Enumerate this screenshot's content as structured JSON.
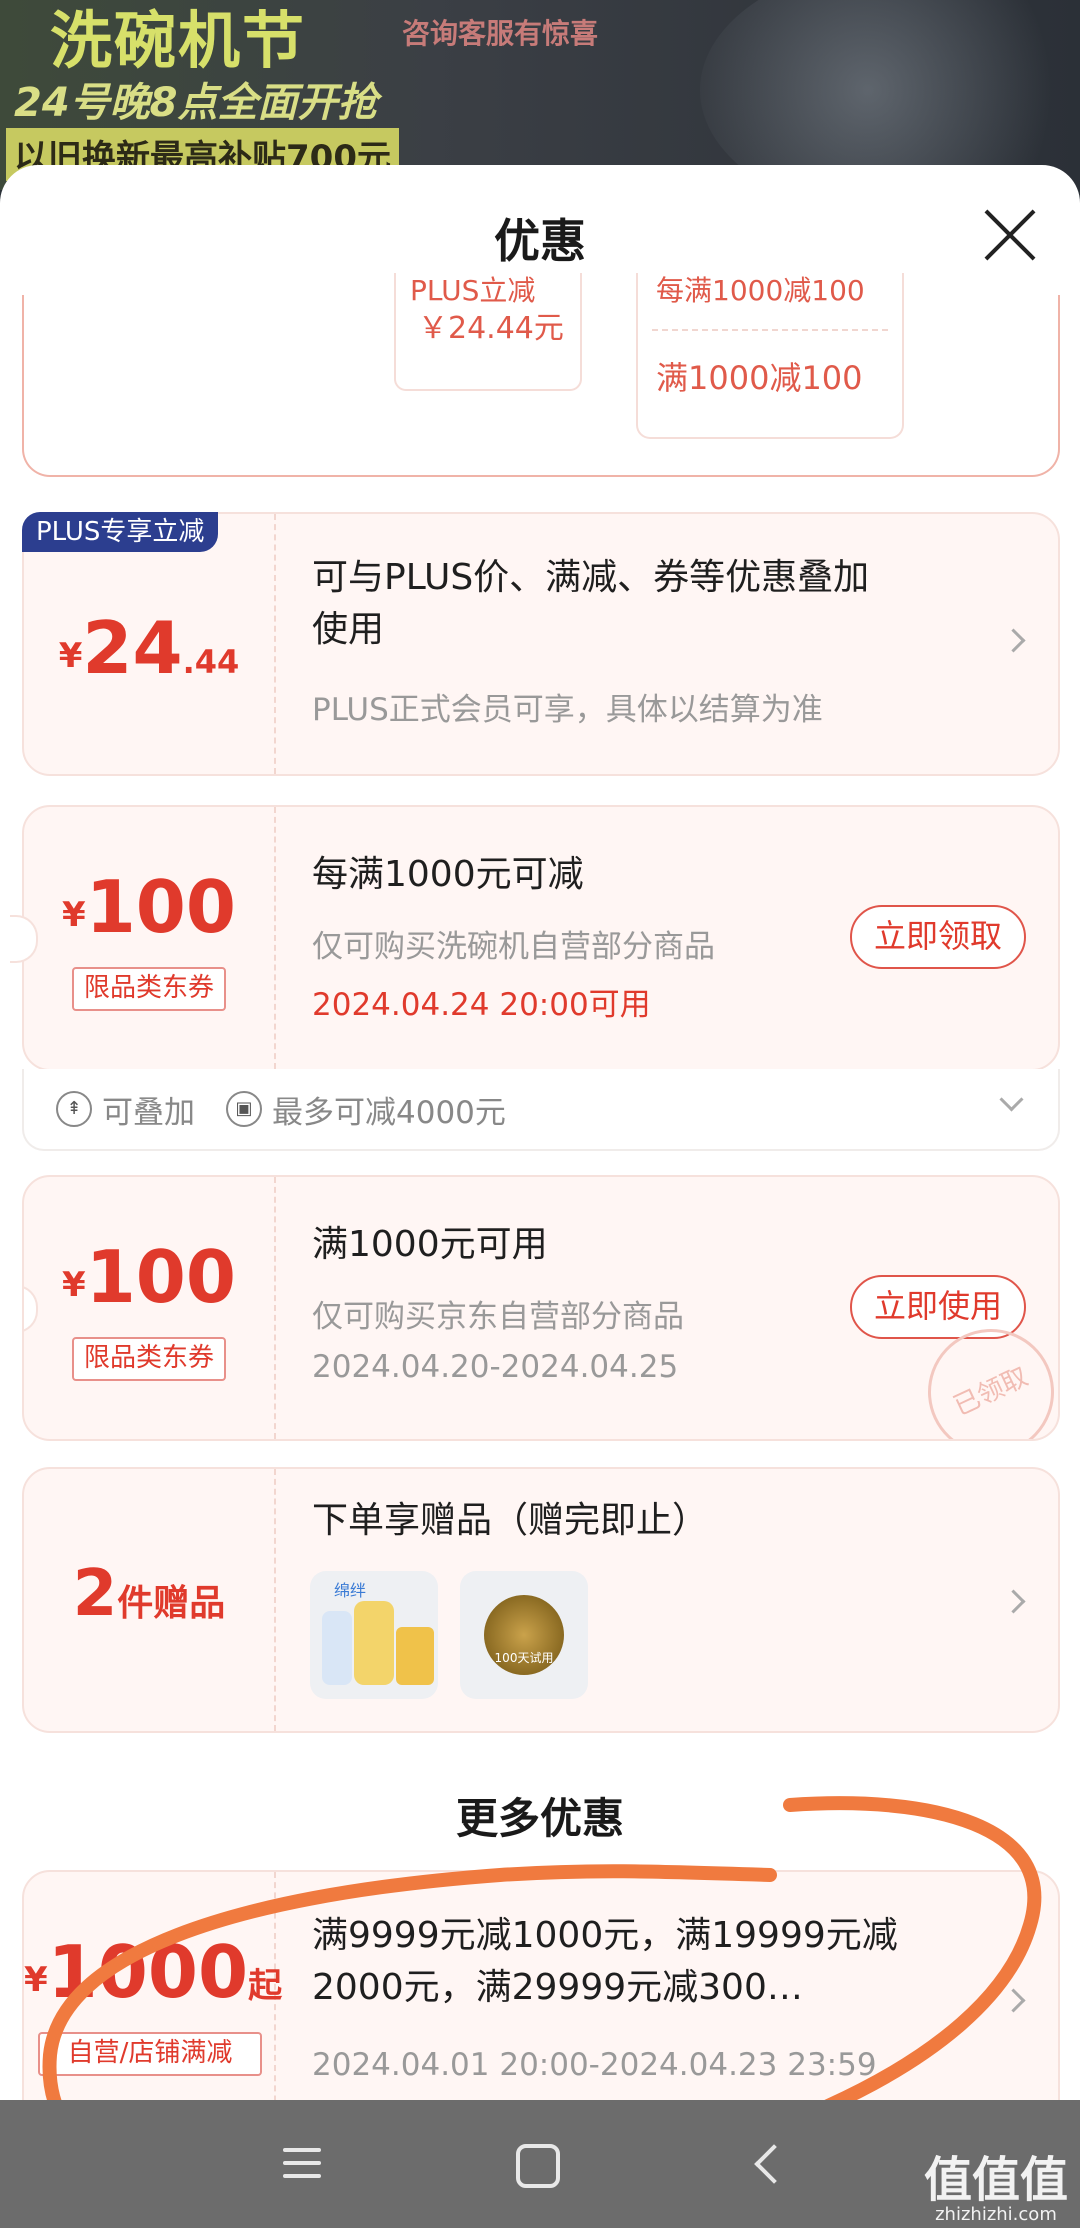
{
  "banner": {
    "title": "洗碗机节",
    "subtitle": "24号晚8点全面开抢",
    "tradein": "以旧换新最高补贴700元",
    "service": "咨询客服有惊喜"
  },
  "sheet": {
    "title": "优惠"
  },
  "top_card": {
    "mini1_line1": "PLUS立减",
    "mini1_line2": "￥24.44元",
    "mini2_line1": "每满1000减100",
    "mini2_line2": "满1000减100"
  },
  "plus_card": {
    "badge": "PLUS专享立减",
    "yen": "¥",
    "amount_int": "24",
    "amount_dec": ".44",
    "title": "可与PLUS价、满减、券等优惠叠加使用",
    "subtitle": "PLUS正式会员可享，具体以结算为准"
  },
  "coupon1": {
    "yen": "¥",
    "amount": "100",
    "tag": "限品类东券",
    "title": "每满1000元可减",
    "subtitle": "仅可购买洗碗机自营部分商品",
    "date": "2024.04.24 20:00可用",
    "button": "立即领取",
    "stack_label": "可叠加",
    "max_label": "最多可减4000元"
  },
  "coupon2": {
    "yen": "¥",
    "amount": "100",
    "tag": "限品类东券",
    "title": "满1000元可用",
    "subtitle": "仅可购买京东自营部分商品",
    "date": "2024.04.20-2024.04.25",
    "button": "立即使用",
    "stamp": "已领取"
  },
  "gift_card": {
    "count": "2",
    "unit": "件赠品",
    "title": "下单享赠品（赠完即止）",
    "gift1_brand": "绵绊",
    "gift2_label": "100天试用"
  },
  "more": {
    "title": "更多优惠",
    "yen": "¥",
    "amount": "1000",
    "suffix": "起",
    "tag": "自营/店铺满减",
    "title_text": "满9999元减1000元，满19999元减2000元，满29999元减300…",
    "date": "2024.04.01 20:00-2024.04.23 23:59"
  },
  "watermark": {
    "brand": "值值值",
    "site": "zhizhizhi.com"
  }
}
